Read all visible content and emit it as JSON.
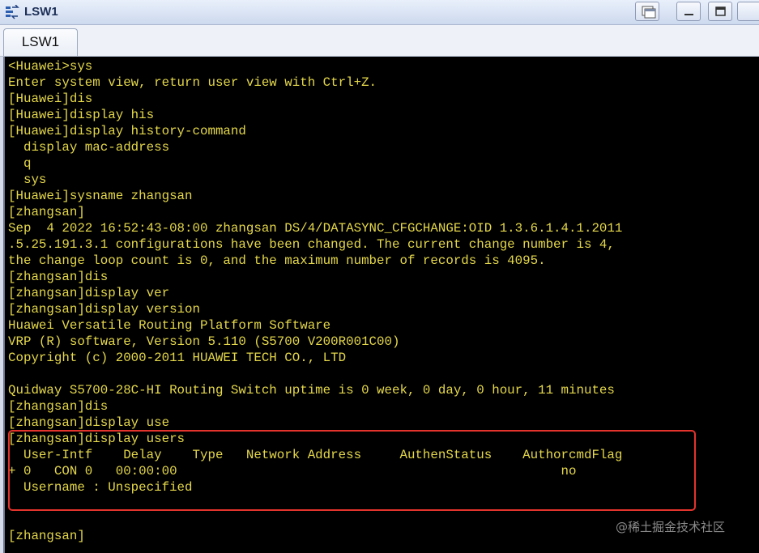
{
  "window": {
    "title": "LSW1",
    "colors": {
      "terminal_bg": "#000000",
      "terminal_text": "#e5d84a",
      "highlight_border": "#e4332c"
    },
    "icons": [
      "app-icon",
      "restore-icon",
      "minimize-icon",
      "maximize-icon"
    ]
  },
  "tabs": [
    {
      "label": "LSW1",
      "active": true
    }
  ],
  "terminal": {
    "lines": [
      "<Huawei>sys",
      "Enter system view, return user view with Ctrl+Z.",
      "[Huawei]dis",
      "[Huawei]display his",
      "[Huawei]display history-command",
      "  display mac-address",
      "  q",
      "  sys",
      "[Huawei]sysname zhangsan",
      "[zhangsan]",
      "Sep  4 2022 16:52:43-08:00 zhangsan DS/4/DATASYNC_CFGCHANGE:OID 1.3.6.1.4.1.2011",
      ".5.25.191.3.1 configurations have been changed. The current change number is 4,",
      "the change loop count is 0, and the maximum number of records is 4095.",
      "[zhangsan]dis",
      "[zhangsan]display ver",
      "[zhangsan]display version",
      "Huawei Versatile Routing Platform Software",
      "VRP (R) software, Version 5.110 (S5700 V200R001C00)",
      "Copyright (c) 2000-2011 HUAWEI TECH CO., LTD",
      "",
      "Quidway S5700-28C-HI Routing Switch uptime is 0 week, 0 day, 0 hour, 11 minutes",
      "[zhangsan]dis",
      "[zhangsan]display use",
      "[zhangsan]display users",
      "  User-Intf    Delay    Type   Network Address     AuthenStatus    AuthorcmdFlag",
      "+ 0   CON 0   00:00:00                                                  no",
      "  Username : Unspecified",
      "",
      "",
      "[zhangsan]"
    ]
  },
  "watermark": "@稀土掘金技术社区"
}
